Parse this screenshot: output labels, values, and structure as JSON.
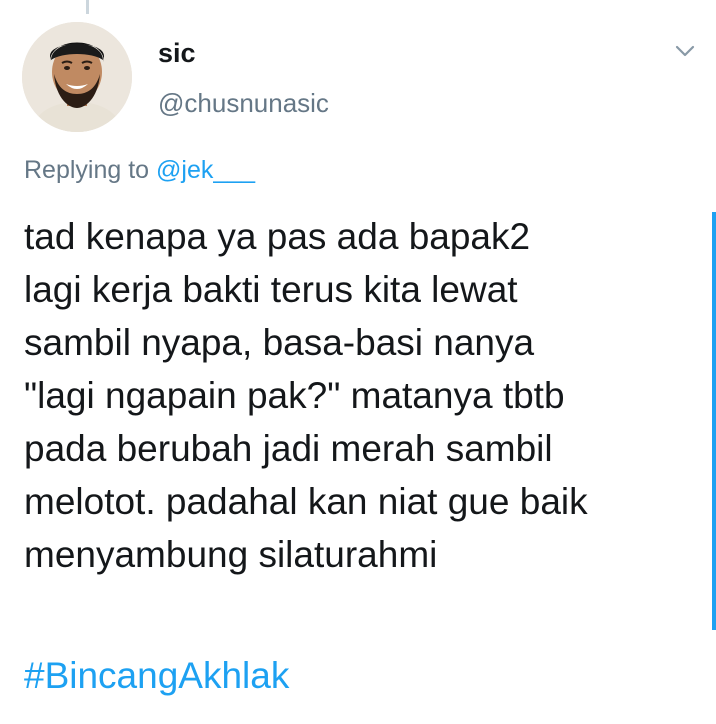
{
  "tweet": {
    "author": {
      "display_name": "sic",
      "handle": "@chusnunasic"
    },
    "menu_icon": "chevron-down-icon",
    "replying_prefix": "Replying to ",
    "replying_to": "@jek___",
    "text": "tad kenapa ya pas ada bapak2\nlagi kerja bakti terus kita lewat\nsambil nyapa, basa-basi nanya\n\"lagi ngapain pak?\" matanya tbtb\npada berubah jadi merah sambil\nmelotot. padahal kan niat gue baik\nmenyambung silaturahmi",
    "hashtag": "#BincangAkhlak"
  },
  "colors": {
    "text": "#14171a",
    "secondary": "#657786",
    "accent": "#1da1f2",
    "thread_line": "#ccd6dd"
  }
}
